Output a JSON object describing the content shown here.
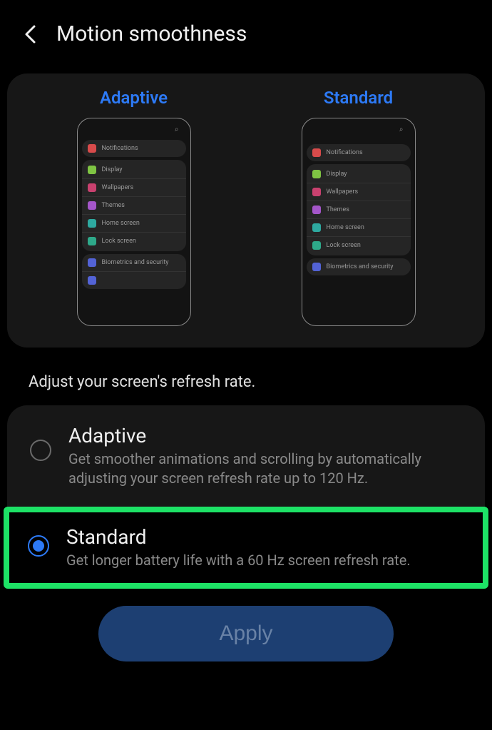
{
  "header": {
    "title": "Motion smoothness"
  },
  "preview": {
    "adaptive_label": "Adaptive",
    "standard_label": "Standard",
    "items_notifications": "Notifications",
    "items_display": "Display",
    "items_wallpapers": "Wallpapers",
    "items_themes": "Themes",
    "items_home": "Home screen",
    "items_lock": "Lock screen",
    "items_bio": "Biometrics and security"
  },
  "section_label": "Adjust your screen's refresh rate.",
  "options": {
    "adaptive": {
      "title": "Adaptive",
      "desc": "Get smoother animations and scrolling by automatically adjusting your screen refresh rate up to 120 Hz."
    },
    "standard": {
      "title": "Standard",
      "desc": "Get longer battery life with a 60 Hz screen refresh rate."
    }
  },
  "apply_label": "Apply"
}
